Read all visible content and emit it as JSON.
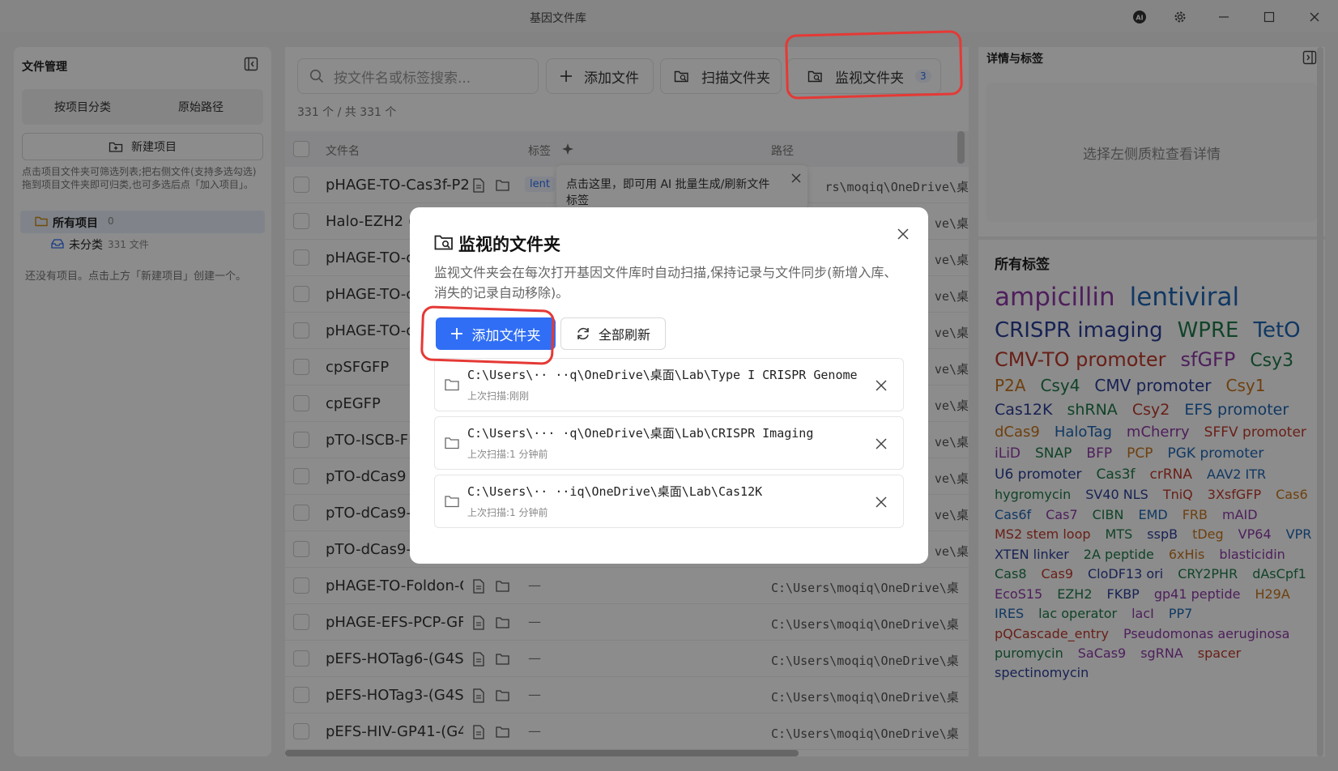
{
  "window": {
    "title": "基因文件库"
  },
  "left": {
    "title": "文件管理",
    "seg": [
      "按项目分类",
      "原始路径"
    ],
    "new_project": "新建项目",
    "hint": "点击项目文件夹可筛选列表;把右侧文件(支持多选勾选)拖到项目文件夹即可归类,也可多选后点「加入项目」。",
    "all_projects": {
      "label": "所有项目",
      "count": "0"
    },
    "unclassified": {
      "label": "未分类",
      "count": "331 文件"
    },
    "empty": "还没有项目。点击上方「新建项目」创建一个。"
  },
  "center": {
    "search_placeholder": "按文件名或标签搜索...",
    "add_file": "添加文件",
    "scan_folder": "扫描文件夹",
    "watch_folder": "监视文件夹",
    "watch_count": "3",
    "count": "331 个 / 共 331 个",
    "headers": {
      "name": "文件名",
      "tags": "标签",
      "path": "路径"
    },
    "first_tag": "lent",
    "tooltip": "点击这里，即可用 AI 批量生成/刷新文件标签",
    "rows": [
      {
        "name": "pHAGE-TO-Cas3f-P2",
        "path": "rs\\moqiq\\OneDrive\\桌"
      },
      {
        "name": "Halo-EZH2 (",
        "path": "ve\\桌"
      },
      {
        "name": "pHAGE-TO-c",
        "path": "ve\\桌"
      },
      {
        "name": "pHAGE-TO-c",
        "path": "ve\\桌"
      },
      {
        "name": "pHAGE-TO-c",
        "path": "ve\\桌"
      },
      {
        "name": "cpSFGFP",
        "path": "ve\\桌"
      },
      {
        "name": "cpEGFP",
        "path": "ve\\桌"
      },
      {
        "name": "pTO-ISCB-FK",
        "path": "ve\\桌"
      },
      {
        "name": "pTO-dCas9",
        "path": "ve\\桌"
      },
      {
        "name": "pTO-dCas9-I",
        "path": "ve\\桌"
      },
      {
        "name": "pTO-dCas9-I",
        "path": "ve\\桌"
      },
      {
        "name": "pHAGE-TO-Foldon-C",
        "tag": "—",
        "path": "C:\\Users\\moqiq\\OneDrive\\桌"
      },
      {
        "name": "pHAGE-EFS-PCP-GFI",
        "tag": "—",
        "path": "C:\\Users\\moqiq\\OneDrive\\桌"
      },
      {
        "name": "pEFS-HOTag6-(G4S)",
        "tag": "—",
        "path": "C:\\Users\\moqiq\\OneDrive\\桌"
      },
      {
        "name": "pEFS-HOTag3-(G4S)",
        "tag": "—",
        "path": "C:\\Users\\moqiq\\OneDrive\\桌"
      },
      {
        "name": "pEFS-HIV-GP41-(G4",
        "tag": "—",
        "path": "C:\\Users\\moqiq\\OneDrive\\桌"
      }
    ]
  },
  "right": {
    "title": "详情与标签",
    "detail_placeholder": "选择左侧质粒查看详情",
    "all_tags_title": "所有标签",
    "tags": [
      {
        "t": "ampicillin",
        "c": "#8e3aa8",
        "s": 31
      },
      {
        "t": "lentiviral",
        "c": "#1e66b5",
        "s": 31
      },
      {
        "t": "CRISPR imaging",
        "c": "#2b3f9a",
        "s": 26
      },
      {
        "t": "WPRE",
        "c": "#1e7a4a",
        "s": 26
      },
      {
        "t": "TetO",
        "c": "#1e66b5",
        "s": 26
      },
      {
        "t": "CMV-TO promoter",
        "c": "#c0392b",
        "s": 24
      },
      {
        "t": "sfGFP",
        "c": "#8e3aa8",
        "s": 24
      },
      {
        "t": "Csy3",
        "c": "#1e7a4a",
        "s": 22
      },
      {
        "t": "P2A",
        "c": "#c8761a",
        "s": 20
      },
      {
        "t": "Csy4",
        "c": "#1e7a4a",
        "s": 20
      },
      {
        "t": "CMV promoter",
        "c": "#2b3f9a",
        "s": 20
      },
      {
        "t": "Csy1",
        "c": "#c8761a",
        "s": 20
      },
      {
        "t": "Cas12K",
        "c": "#2b3f9a",
        "s": 19
      },
      {
        "t": "shRNA",
        "c": "#1e7a4a",
        "s": 19
      },
      {
        "t": "Csy2",
        "c": "#c0392b",
        "s": 19
      },
      {
        "t": "EFS promoter",
        "c": "#1e66b5",
        "s": 19
      },
      {
        "t": "dCas9",
        "c": "#c8761a",
        "s": 18
      },
      {
        "t": "HaloTag",
        "c": "#1e66b5",
        "s": 18
      },
      {
        "t": "mCherry",
        "c": "#8e3aa8",
        "s": 18
      },
      {
        "t": "SFFV promoter",
        "c": "#c0392b",
        "s": 17
      },
      {
        "t": "iLiD",
        "c": "#8e3aa8",
        "s": 17
      },
      {
        "t": "SNAP",
        "c": "#1e7a4a",
        "s": 17
      },
      {
        "t": "BFP",
        "c": "#8e3aa8",
        "s": 17
      },
      {
        "t": "PCP",
        "c": "#c8761a",
        "s": 17
      },
      {
        "t": "PGK promoter",
        "c": "#1e66b5",
        "s": 17
      },
      {
        "t": "U6 promoter",
        "c": "#2b3f9a",
        "s": 17
      },
      {
        "t": "Cas3f",
        "c": "#1e7a4a",
        "s": 17
      },
      {
        "t": "crRNA",
        "c": "#c0392b",
        "s": 17
      },
      {
        "t": "AAV2 ITR",
        "c": "#1e66b5",
        "s": 16
      },
      {
        "t": "hygromycin",
        "c": "#1e7a4a",
        "s": 16
      },
      {
        "t": "SV40 NLS",
        "c": "#2b3f9a",
        "s": 16
      },
      {
        "t": "TniQ",
        "c": "#c0392b",
        "s": 16
      },
      {
        "t": "3XsfGFP",
        "c": "#c0392b",
        "s": 16
      },
      {
        "t": "Cas6",
        "c": "#c8761a",
        "s": 16
      },
      {
        "t": "Cas6f",
        "c": "#1e66b5",
        "s": 16
      },
      {
        "t": "Cas7",
        "c": "#8e3aa8",
        "s": 16
      },
      {
        "t": "CIBN",
        "c": "#1e7a4a",
        "s": 16
      },
      {
        "t": "EMD",
        "c": "#1e66b5",
        "s": 16
      },
      {
        "t": "FRB",
        "c": "#c8761a",
        "s": 16
      },
      {
        "t": "mAID",
        "c": "#8e3aa8",
        "s": 16
      },
      {
        "t": "MS2 stem loop",
        "c": "#c0392b",
        "s": 16
      },
      {
        "t": "MTS",
        "c": "#1e7a4a",
        "s": 16
      },
      {
        "t": "sspB",
        "c": "#2b3f9a",
        "s": 16
      },
      {
        "t": "tDeg",
        "c": "#c8761a",
        "s": 16
      },
      {
        "t": "VP64",
        "c": "#8e3aa8",
        "s": 16
      },
      {
        "t": "VPR",
        "c": "#1e66b5",
        "s": 16
      },
      {
        "t": "XTEN linker",
        "c": "#2b3f9a",
        "s": 16
      },
      {
        "t": "2A peptide",
        "c": "#1e7a4a",
        "s": 16
      },
      {
        "t": "6xHis",
        "c": "#c8761a",
        "s": 16
      },
      {
        "t": "blasticidin",
        "c": "#8e3aa8",
        "s": 16
      },
      {
        "t": "Cas8",
        "c": "#1e7a4a",
        "s": 16
      },
      {
        "t": "Cas9",
        "c": "#c0392b",
        "s": 16
      },
      {
        "t": "CloDF13 ori",
        "c": "#2b3f9a",
        "s": 16
      },
      {
        "t": "CRY2PHR",
        "c": "#1e7a4a",
        "s": 16
      },
      {
        "t": "dAsCpf1",
        "c": "#1e7a4a",
        "s": 16
      },
      {
        "t": "EcoS15",
        "c": "#8e3aa8",
        "s": 16
      },
      {
        "t": "EZH2",
        "c": "#1e7a4a",
        "s": 16
      },
      {
        "t": "FKBP",
        "c": "#2b3f9a",
        "s": 16
      },
      {
        "t": "gp41 peptide",
        "c": "#8e3aa8",
        "s": 16
      },
      {
        "t": "H29A",
        "c": "#c8761a",
        "s": 16
      },
      {
        "t": "IRES",
        "c": "#1e66b5",
        "s": 16
      },
      {
        "t": "lac operator",
        "c": "#1e7a4a",
        "s": 16
      },
      {
        "t": "lacI",
        "c": "#8e3aa8",
        "s": 16
      },
      {
        "t": "PP7",
        "c": "#1e66b5",
        "s": 16
      },
      {
        "t": "pQCascade_entry",
        "c": "#c0392b",
        "s": 16
      },
      {
        "t": "Pseudomonas aeruginosa",
        "c": "#8e3aa8",
        "s": 16
      },
      {
        "t": "puromycin",
        "c": "#1e7a4a",
        "s": 16
      },
      {
        "t": "SaCas9",
        "c": "#8e3aa8",
        "s": 16
      },
      {
        "t": "sgRNA",
        "c": "#8e3aa8",
        "s": 16
      },
      {
        "t": "spacer",
        "c": "#c0392b",
        "s": 16
      },
      {
        "t": "spectinomycin",
        "c": "#2b3f9a",
        "s": 16
      }
    ]
  },
  "modal": {
    "title": "监视的文件夹",
    "desc": "监视文件夹会在每次打开基因文件库时自动扫描,保持记录与文件同步(新增入库、消失的记录自动移除)。",
    "add": "添加文件夹",
    "refresh": "全部刷新",
    "folders": [
      {
        "path": "C:\\Users\\·· ··q\\OneDrive\\桌面\\Lab\\Type I CRISPR Genome",
        "sub": "上次扫描:刚刚"
      },
      {
        "path": "C:\\Users\\··· ·q\\OneDrive\\桌面\\Lab\\CRISPR Imaging",
        "sub": "上次扫描:1 分钟前"
      },
      {
        "path": "C:\\Users\\·· ··iq\\OneDrive\\桌面\\Lab\\Cas12K",
        "sub": "上次扫描:1 分钟前"
      }
    ]
  },
  "colors": {
    "accent": "#2f6ef5",
    "annotation": "#e53935"
  }
}
